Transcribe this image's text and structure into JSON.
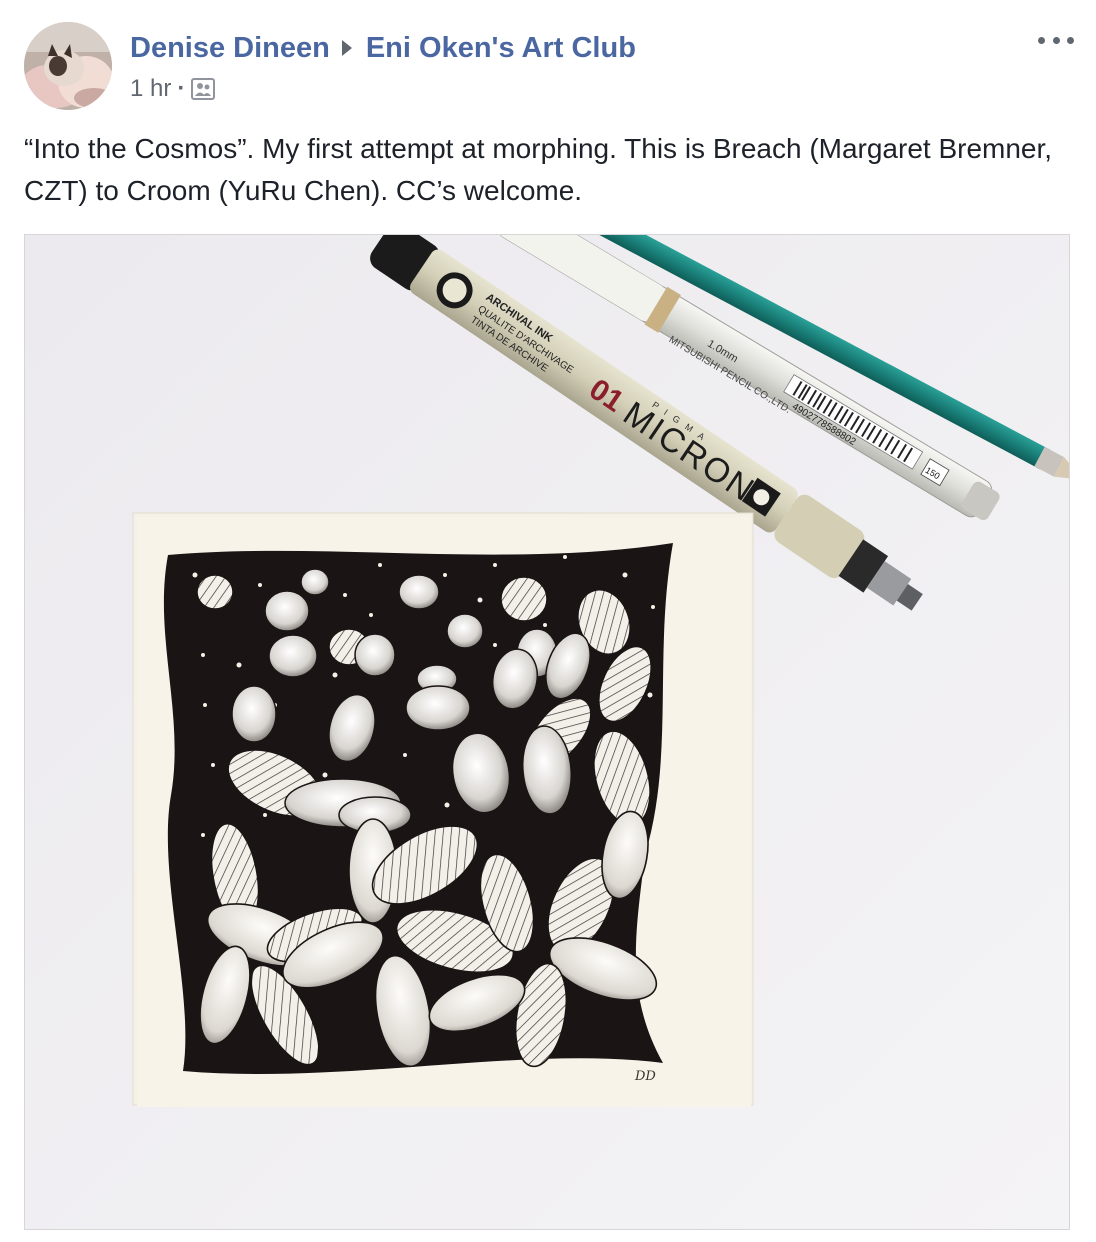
{
  "post": {
    "author": "Denise Dineen",
    "group": "Eni Oken's Art Club",
    "timestamp": "1 hr",
    "separator": "·",
    "audience_icon": "group-audience-icon",
    "more_icon": "more-options-icon",
    "text": "“Into the Cosmos”. My first attempt at morphing. This is Breach (Margaret Bremner, CZT) to Croom (YuRu Chen). CC’s welcome."
  },
  "photo": {
    "subject": "zentangle-tile-with-pens",
    "pen_labels": {
      "micron_brand": "MICRON",
      "micron_size": "01",
      "micron_maker": "PIGMA",
      "archival": "ARCHIVAL INK",
      "qualite": "QUALITE D'ARCHIVAGE",
      "tinta": "TINTA DE ARCHIVE",
      "gel_size": "1.0mm",
      "gel_maker": "MITSUBISHI PENCIL CO.,LTD.",
      "barcode": "4902778588802",
      "gel_code": "150"
    },
    "signature": "DD"
  },
  "colors": {
    "link": "#4b67a1",
    "meta": "#616770",
    "text": "#1d2129",
    "photo_bg": "#efeef0",
    "paper": "#f5f1e6",
    "ink": "#1a1414"
  }
}
